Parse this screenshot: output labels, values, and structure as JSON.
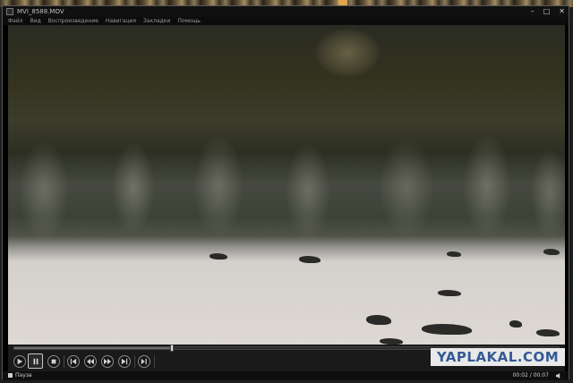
{
  "window": {
    "title": "MVI_8588.MOV"
  },
  "menu": {
    "items": [
      "Файл",
      "Вид",
      "Воспроизведение",
      "Навигация",
      "Закладки",
      "Помощь"
    ]
  },
  "playback": {
    "progress": 0.29
  },
  "watermark": {
    "text": "YAPLAKAL.COM"
  },
  "status": {
    "state": "Пауза",
    "time": "00:02 / 00:07"
  },
  "icons": {
    "play": "play-icon",
    "pause": "pause-icon",
    "stop": "stop-icon",
    "prev": "previous-icon",
    "rewind": "rewind-icon",
    "forward": "forward-icon",
    "next": "next-icon",
    "frame": "frame-step-icon",
    "volume": "speaker-icon"
  }
}
